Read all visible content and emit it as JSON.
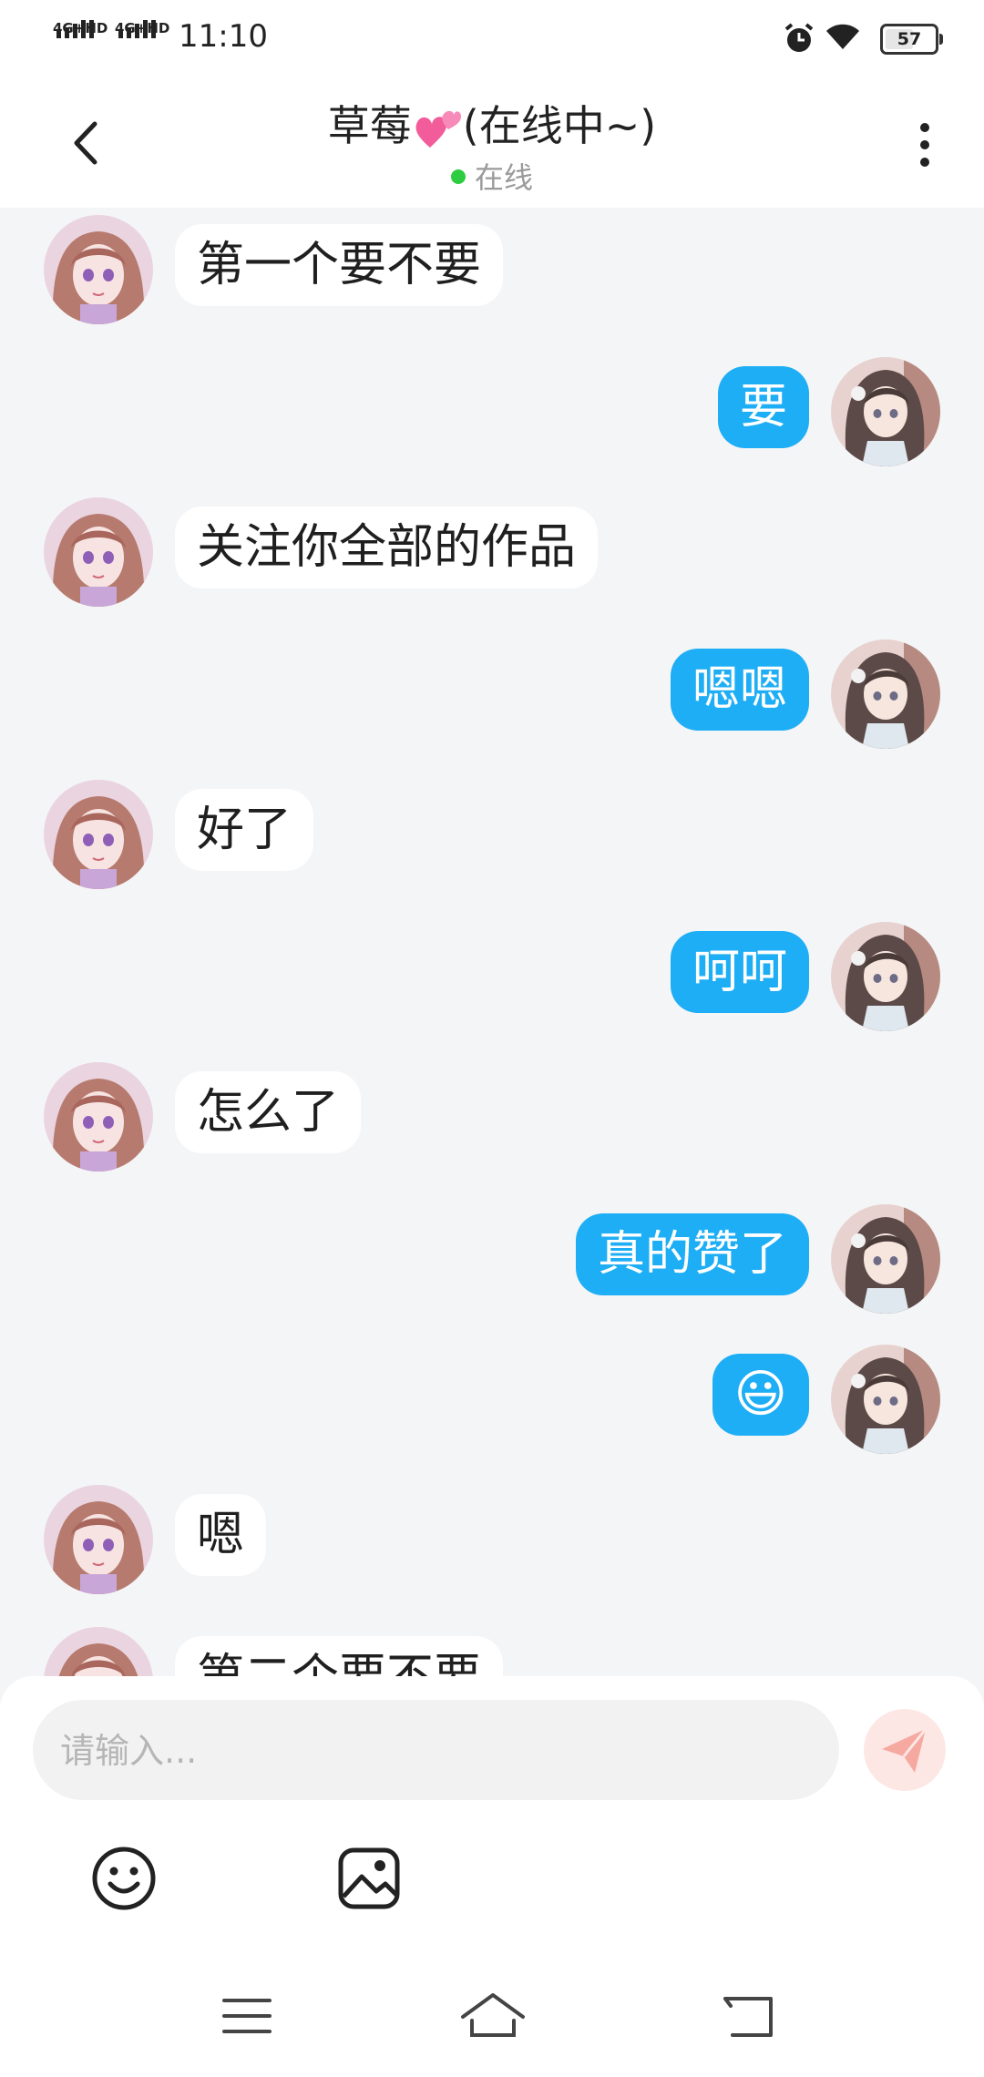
{
  "status_bar": {
    "network1": "4G+HD",
    "network2": "4G+HD",
    "time": "11:10",
    "battery": "57",
    "battery_level": 0.57
  },
  "header": {
    "title": "草莓",
    "title_suffix": "(在线中~)",
    "status": "在线"
  },
  "messages": [
    {
      "side": "left",
      "text": "第一个要不要"
    },
    {
      "side": "right",
      "text": "要"
    },
    {
      "side": "left",
      "text": "关注你全部的作品"
    },
    {
      "side": "right",
      "text": "嗯嗯"
    },
    {
      "side": "left",
      "text": "好了"
    },
    {
      "side": "right",
      "text": "呵呵"
    },
    {
      "side": "left",
      "text": "怎么了"
    },
    {
      "side": "right",
      "text": "真的赞了"
    },
    {
      "side": "right",
      "text": "😃"
    },
    {
      "side": "left",
      "text": "嗯"
    },
    {
      "side": "left",
      "text": "第二个要不要"
    }
  ],
  "input": {
    "placeholder": "请输入..."
  },
  "colors": {
    "own_bubble": "#1eaef5",
    "other_bubble": "#ffffff",
    "background": "#f4f5f7",
    "online_dot": "#2ecc40",
    "send_button": "#fde7e5",
    "send_icon": "#f5a9a1"
  },
  "icons": {
    "back": "chevron-left-icon",
    "more": "more-vertical-icon",
    "emoji": "emoji-icon",
    "image": "image-icon",
    "send": "send-icon",
    "nav_menu": "menu-icon",
    "nav_home": "home-icon",
    "nav_back": "back-icon"
  }
}
